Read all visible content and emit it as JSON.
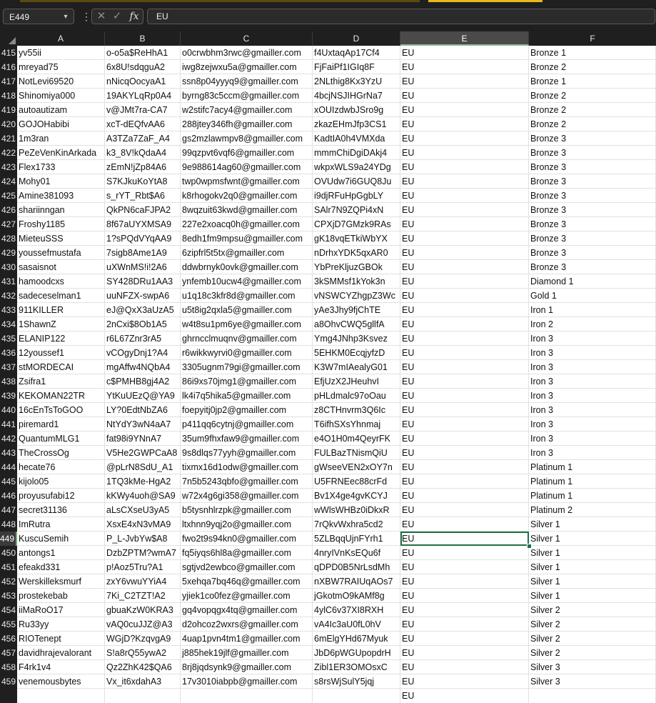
{
  "formula_bar": {
    "name_box": "E449",
    "formula_value": "EU",
    "cancel_glyph": "✕",
    "enter_glyph": "✓",
    "fx_glyph": "fx",
    "dots_glyph": "⋮",
    "chevron_glyph": "▾"
  },
  "columns": [
    "A",
    "B",
    "C",
    "D",
    "E",
    "F"
  ],
  "active_column": "E",
  "active_row": "449",
  "rows": [
    {
      "n": "415",
      "a": "yv55ii",
      "b": "o-o5a$ReHhA1",
      "c": "o0crwbhm3rwc@gmailler.com",
      "d": "f4UxtaqAp17Cf4",
      "e": "EU",
      "f": "Bronze 1"
    },
    {
      "n": "416",
      "a": "mreyad75",
      "b": "6x8U!sdqguA2",
      "c": "iwg8zejwxu5a@gmailler.com",
      "d": "FjFaiPf1IGIq8F",
      "e": "EU",
      "f": "Bronze 2"
    },
    {
      "n": "417",
      "a": "NotLevi69520",
      "b": "nNicqOocyaA1",
      "c": "ssn8p04yyyq9@gmailler.com",
      "d": "2NLthig8Kx3YzU",
      "e": "EU",
      "f": "Bronze 1"
    },
    {
      "n": "418",
      "a": "Shinomiya000",
      "b": "19AKYLqRp0A4",
      "c": "byrng83c5ccm@gmailler.com",
      "d": "4bcjNSJIHGrNa7",
      "e": "EU",
      "f": "Bronze 2"
    },
    {
      "n": "419",
      "a": "autoautizam",
      "b": "v@JMt7ra-CA7",
      "c": "w2stifc7acy4@gmailler.com",
      "d": "xOUIzdwbJSro9g",
      "e": "EU",
      "f": "Bronze 2"
    },
    {
      "n": "420",
      "a": "GOJOHabibi",
      "b": "xcT-dEQfvAA6",
      "c": "288jtey346fh@gmailler.com",
      "d": "zkazEHmJfp3CS1",
      "e": "EU",
      "f": "Bronze 2"
    },
    {
      "n": "421",
      "a": "1m3ran",
      "b": "A3TZa7ZaF_A4",
      "c": "gs2mzlawmpv8@gmailler.com",
      "d": "KadtIA0h4VMXda",
      "e": "EU",
      "f": "Bronze 3"
    },
    {
      "n": "422",
      "a": "PeZeVenKinArkada",
      "b": "k3_8V!kQdaA4",
      "c": "99qzpvt6vqf6@gmailler.com",
      "d": "mmmChiDgiDAkj4",
      "e": "EU",
      "f": "Bronze 3"
    },
    {
      "n": "423",
      "a": "Flex1733",
      "b": "zEmN!jZp84A6",
      "c": "9e988614ag60@gmailler.com",
      "d": "wkpxWLS9a24YDg",
      "e": "EU",
      "f": "Bronze 3"
    },
    {
      "n": "424",
      "a": "Mohy01",
      "b": "S7KJkuKoYtA8",
      "c": "twp0wpmsfwnt@gmailler.com",
      "d": "OVUdw7i6GUQ8Ju",
      "e": "EU",
      "f": "Bronze 3"
    },
    {
      "n": "425",
      "a": "Amine381093",
      "b": "s_rYT_Rbt$A6",
      "c": "k8rhogokv2q0@gmailler.com",
      "d": "i9djRFuHpGgbLY",
      "e": "EU",
      "f": "Bronze 3"
    },
    {
      "n": "426",
      "a": "shariinngan",
      "b": "QkPN6caFJPA2",
      "c": "8wqzuit63kwd@gmailler.com",
      "d": "SAlr7N9ZQPi4xN",
      "e": "EU",
      "f": "Bronze 3"
    },
    {
      "n": "427",
      "a": "Froshy1185",
      "b": "8f67aUYXMSA9",
      "c": "227e2xoacq0h@gmailler.com",
      "d": "CPXjD7GMzk9RAs",
      "e": "EU",
      "f": "Bronze 3"
    },
    {
      "n": "428",
      "a": "MieteuSSS",
      "b": "1?sPQdVYqAA9",
      "c": "8edh1fm9mpsu@gmailler.com",
      "d": "gK18vqETkiWbYX",
      "e": "EU",
      "f": "Bronze 3"
    },
    {
      "n": "429",
      "a": "youssefmustafa",
      "b": "7sigb8Ame1A9",
      "c": "6zipfrl5t5tx@gmailler.com",
      "d": "nDrhxYDK5qxAR0",
      "e": "EU",
      "f": "Bronze 3"
    },
    {
      "n": "430",
      "a": "sasaisnot",
      "b": "uXWnMS!i!2A6",
      "c": "ddwbrnyk0ovk@gmailler.com",
      "d": "YbPreKljuzGBOk",
      "e": "EU",
      "f": "Bronze 3"
    },
    {
      "n": "431",
      "a": "hamoodcxs",
      "b": "SY428DRu1AA3",
      "c": "ynfemb10ucw4@gmailler.com",
      "d": "3kSMMsf1kYok3n",
      "e": "EU",
      "f": "Diamond 1"
    },
    {
      "n": "432",
      "a": "sadeceselman1",
      "b": "uuNFZX-swpA6",
      "c": "u1q18c3kfr8d@gmailler.com",
      "d": "vNSWCYZhgpZ3Wc",
      "e": "EU",
      "f": "Gold 1"
    },
    {
      "n": "433",
      "a": "911KILLER",
      "b": "eJ@QxX3aUzA5",
      "c": "u5t8ig2qxla5@gmailler.com",
      "d": "yAe3Jhy9fjChTE",
      "e": "EU",
      "f": "Iron 1"
    },
    {
      "n": "434",
      "a": "1ShawnZ",
      "b": "2nCxi$8Ob1A5",
      "c": "w4t8su1pm6ye@gmailler.com",
      "d": "a8OhvCWQ5gllfA",
      "e": "EU",
      "f": "Iron 2"
    },
    {
      "n": "435",
      "a": "ELANIP122",
      "b": "r6L67Znr3rA5",
      "c": "ghrncclmuqnv@gmailler.com",
      "d": "Ymg4JNhp3Ksvez",
      "e": "EU",
      "f": "Iron 3"
    },
    {
      "n": "436",
      "a": "12youssef1",
      "b": "vCOgyDnj1?A4",
      "c": "r6wikkwyrvi0@gmailler.com",
      "d": "5EHKM0EcqjyfzD",
      "e": "EU",
      "f": "Iron 3"
    },
    {
      "n": "437",
      "a": "stMORDECAI",
      "b": "mgAffw4NQbA4",
      "c": "3305ugnm79gi@gmailler.com",
      "d": "K3W7mIAealyG01",
      "e": "EU",
      "f": "Iron 3"
    },
    {
      "n": "438",
      "a": "Zsifra1",
      "b": "c$PMHB8gj4A2",
      "c": "86i9xs70jmg1@gmailler.com",
      "d": "EfjUzX2JHeuhvI",
      "e": "EU",
      "f": "Iron 3"
    },
    {
      "n": "439",
      "a": "KEKOMAN22TR",
      "b": "YtKuUEzQ@YA9",
      "c": "lk4i7q5hika5@gmailler.com",
      "d": "pHLdmalc97oOau",
      "e": "EU",
      "f": "Iron 3"
    },
    {
      "n": "440",
      "a": "16cEnTsToGOO",
      "b": "LY?0EdtNbZA6",
      "c": "foepyitj0jp2@gmailler.com",
      "d": "z8CTHnvrm3Q6Ic",
      "e": "EU",
      "f": "Iron 3"
    },
    {
      "n": "441",
      "a": "piremard1",
      "b": "NtYdY3wN4aA7",
      "c": "p411qq6cytnj@gmailler.com",
      "d": "T6ifhSXsYhnmaj",
      "e": "EU",
      "f": "Iron 3"
    },
    {
      "n": "442",
      "a": "QuantumMLG1",
      "b": "fat98i9YNnA7",
      "c": "35um9fhxfaw9@gmailler.com",
      "d": "e4O1H0m4QeyrFK",
      "e": "EU",
      "f": "Iron 3"
    },
    {
      "n": "443",
      "a": "TheCrossOg",
      "b": "V5He2GWPCaA8",
      "c": "9s8dlqs77yyh@gmailler.com",
      "d": "FULBazTNismQiU",
      "e": "EU",
      "f": "Iron 3"
    },
    {
      "n": "444",
      "a": "hecate76",
      "b": "@pLrN8SdU_A1",
      "c": "tixmx16d1odw@gmailler.com",
      "d": "gWseeVEN2xOY7n",
      "e": "EU",
      "f": "Platinum 1"
    },
    {
      "n": "445",
      "a": "kijolo05",
      "b": "1TQ3kMe-HgA2",
      "c": "7n5b5243qbfo@gmailler.com",
      "d": "U5FRNEec88crFd",
      "e": "EU",
      "f": "Platinum 1"
    },
    {
      "n": "446",
      "a": "proyusufabi12",
      "b": "kKWy4uoh@SA9",
      "c": "w72x4g6gi358@gmailler.com",
      "d": "Bv1X4ge4gvKCYJ",
      "e": "EU",
      "f": "Platinum 1"
    },
    {
      "n": "447",
      "a": "secret31136",
      "b": "aLsCXseU3yA5",
      "c": "b5tysnhlrzpk@gmailler.com",
      "d": "wWlsWHBz0iDkxR",
      "e": "EU",
      "f": "Platinum 2"
    },
    {
      "n": "448",
      "a": "ImRutra",
      "b": "XsxE4xN3vMA9",
      "c": "ltxhnn9yqj2o@gmailler.com",
      "d": "7rQkvWxhra5cd2",
      "e": "EU",
      "f": "Silver 1"
    },
    {
      "n": "449",
      "a": "KuscuSemih",
      "b": "P_L-JvbYw$A8",
      "c": "fwo2t9s94kn0@gmailler.com",
      "d": "5ZLBqqUjnFYrh1",
      "e": "EU",
      "f": "Silver 1"
    },
    {
      "n": "450",
      "a": "antongs1",
      "b": "DzbZPTM?wmA7",
      "c": "fq5iyqs6hl8a@gmailler.com",
      "d": "4nryIVnKsEQu6f",
      "e": "EU",
      "f": "Silver 1"
    },
    {
      "n": "451",
      "a": "efeakd331",
      "b": "p!Aoz5Tru?A1",
      "c": "sgtjvd2ewbco@gmailler.com",
      "d": "qDPD0B5NrLsdMh",
      "e": "EU",
      "f": "Silver 1"
    },
    {
      "n": "452",
      "a": "Werskilleksmurf",
      "b": "zxY6vwuYYiA4",
      "c": "5xehqa7bq46q@gmailler.com",
      "d": "nXBW7RAIUqAOs7",
      "e": "EU",
      "f": "Silver 1"
    },
    {
      "n": "453",
      "a": "prostekebab",
      "b": "7Ki_C2TZT!A2",
      "c": "yjiek1co0fez@gmailler.com",
      "d": "jGkotmO9kAMf8g",
      "e": "EU",
      "f": "Silver 1"
    },
    {
      "n": "454",
      "a": "iiMaRoO17",
      "b": "gbuaKzW0KRA3",
      "c": "gq4vopqgx4tq@gmailler.com",
      "d": "4ylC6v37XI8RXH",
      "e": "EU",
      "f": "Silver 2"
    },
    {
      "n": "455",
      "a": "Ru33yy",
      "b": "vAQ0cuJJZ@A3",
      "c": "d2ohcoz2wxrs@gmailler.com",
      "d": "vA4Ic3aU0fL0hV",
      "e": "EU",
      "f": "Silver 2"
    },
    {
      "n": "456",
      "a": "RIOTenept",
      "b": "WGjD?KzqvgA9",
      "c": "4uap1pvn4tm1@gmailler.com",
      "d": "6mElgYHd67Myuk",
      "e": "EU",
      "f": "Silver 2"
    },
    {
      "n": "457",
      "a": "davidhrajevalorant",
      "b": "S!a8rQ55ywA2",
      "c": "j885hek19jlf@gmailler.com",
      "d": "JbD6pWGUpopdrH",
      "e": "EU",
      "f": "Silver 2"
    },
    {
      "n": "458",
      "a": "F4rk1v4",
      "b": "Qz2ZhK42$QA6",
      "c": "8rj8jqdsynk9@gmailler.com",
      "d": "Zibl1ER3OMOsxC",
      "e": "EU",
      "f": "Silver 3"
    },
    {
      "n": "459",
      "a": "venemousbytes",
      "b": "Vx_it6xdahA3",
      "c": "17v3010iabpb@gmailler.com",
      "d": "s8rsWjSulY5jqj",
      "e": "EU",
      "f": "Silver 3"
    }
  ],
  "partial_row": {
    "e": "EU"
  },
  "colors": {
    "selection_green": "#1e7145",
    "header_bg": "#1f1f1f",
    "grid_line": "#e1e1e1"
  }
}
